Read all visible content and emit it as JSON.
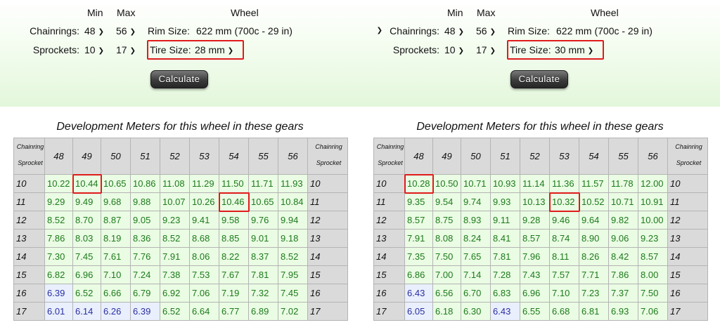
{
  "headers": {
    "min": "Min",
    "max": "Max",
    "wheel": "Wheel"
  },
  "labels": {
    "chainrings": "Chainrings:",
    "sprockets": "Sprockets:",
    "rim_size": "Rim Size:",
    "tire_size": "Tire Size:"
  },
  "panels": [
    {
      "chainring_min": "48",
      "chainring_max": "56",
      "sprocket_min": "10",
      "sprocket_max": "17",
      "rim_size": "622 mm (700c - 29 in)",
      "tire_size": "28 mm",
      "calculate": "Calculate",
      "table_title": "Development Meters for this wheel in these gears",
      "corner_top": "Chainring",
      "corner_bottom": "Sprocket",
      "columns": [
        "48",
        "49",
        "50",
        "51",
        "52",
        "53",
        "54",
        "55",
        "56"
      ],
      "rows": [
        {
          "sprocket": "10",
          "values": [
            "10.22",
            "10.44",
            "10.65",
            "10.86",
            "11.08",
            "11.29",
            "11.50",
            "11.71",
            "11.93"
          ]
        },
        {
          "sprocket": "11",
          "values": [
            "9.29",
            "9.49",
            "9.68",
            "9.88",
            "10.07",
            "10.26",
            "10.46",
            "10.65",
            "10.84"
          ]
        },
        {
          "sprocket": "12",
          "values": [
            "8.52",
            "8.70",
            "8.87",
            "9.05",
            "9.23",
            "9.41",
            "9.58",
            "9.76",
            "9.94"
          ]
        },
        {
          "sprocket": "13",
          "values": [
            "7.86",
            "8.03",
            "8.19",
            "8.36",
            "8.52",
            "8.68",
            "8.85",
            "9.01",
            "9.18"
          ]
        },
        {
          "sprocket": "14",
          "values": [
            "7.30",
            "7.45",
            "7.61",
            "7.76",
            "7.91",
            "8.06",
            "8.22",
            "8.37",
            "8.52"
          ]
        },
        {
          "sprocket": "15",
          "values": [
            "6.82",
            "6.96",
            "7.10",
            "7.24",
            "7.38",
            "7.53",
            "7.67",
            "7.81",
            "7.95"
          ]
        },
        {
          "sprocket": "16",
          "values": [
            "6.39",
            "6.52",
            "6.66",
            "6.79",
            "6.92",
            "7.06",
            "7.19",
            "7.32",
            "7.45"
          ]
        },
        {
          "sprocket": "17",
          "values": [
            "6.01",
            "6.14",
            "6.26",
            "6.39",
            "6.52",
            "6.64",
            "6.77",
            "6.89",
            "7.02"
          ]
        }
      ],
      "blue_cells": [
        [
          6,
          0
        ],
        [
          7,
          0
        ],
        [
          7,
          1
        ],
        [
          7,
          2
        ],
        [
          7,
          3
        ]
      ],
      "highlights": [
        [
          0,
          1
        ],
        [
          1,
          6
        ]
      ]
    },
    {
      "chainring_min": "48",
      "chainring_max": "56",
      "sprocket_min": "10",
      "sprocket_max": "17",
      "rim_size": "622 mm (700c - 29 in)",
      "tire_size": "30 mm",
      "calculate": "Calculate",
      "table_title": "Development Meters for this wheel in these gears",
      "corner_top": "Chainring",
      "corner_bottom": "Sprocket",
      "columns": [
        "48",
        "49",
        "50",
        "51",
        "52",
        "53",
        "54",
        "55",
        "56"
      ],
      "rows": [
        {
          "sprocket": "10",
          "values": [
            "10.28",
            "10.50",
            "10.71",
            "10.93",
            "11.14",
            "11.36",
            "11.57",
            "11.78",
            "12.00"
          ]
        },
        {
          "sprocket": "11",
          "values": [
            "9.35",
            "9.54",
            "9.74",
            "9.93",
            "10.13",
            "10.32",
            "10.52",
            "10.71",
            "10.91"
          ]
        },
        {
          "sprocket": "12",
          "values": [
            "8.57",
            "8.75",
            "8.93",
            "9.11",
            "9.28",
            "9.46",
            "9.64",
            "9.82",
            "10.00"
          ]
        },
        {
          "sprocket": "13",
          "values": [
            "7.91",
            "8.08",
            "8.24",
            "8.41",
            "8.57",
            "8.74",
            "8.90",
            "9.06",
            "9.23"
          ]
        },
        {
          "sprocket": "14",
          "values": [
            "7.35",
            "7.50",
            "7.65",
            "7.81",
            "7.96",
            "8.11",
            "8.26",
            "8.42",
            "8.57"
          ]
        },
        {
          "sprocket": "15",
          "values": [
            "6.86",
            "7.00",
            "7.14",
            "7.28",
            "7.43",
            "7.57",
            "7.71",
            "7.86",
            "8.00"
          ]
        },
        {
          "sprocket": "16",
          "values": [
            "6.43",
            "6.56",
            "6.70",
            "6.83",
            "6.96",
            "7.10",
            "7.23",
            "7.37",
            "7.50"
          ]
        },
        {
          "sprocket": "17",
          "values": [
            "6.05",
            "6.18",
            "6.30",
            "6.43",
            "6.55",
            "6.68",
            "6.81",
            "6.93",
            "7.06"
          ]
        }
      ],
      "blue_cells": [
        [
          6,
          0
        ],
        [
          7,
          0
        ],
        [
          7,
          3
        ]
      ],
      "highlights": [
        [
          0,
          0
        ],
        [
          1,
          5
        ]
      ]
    }
  ],
  "colors": {
    "highlight": "#e01b1b",
    "cell_green_bg": "#eafce3",
    "cell_green_text": "#1d7a1d",
    "cell_blue_bg": "#e9effd",
    "cell_blue_text": "#2b2fa0",
    "header_bg": "#dadada"
  },
  "icons": {
    "select_arrow": "chevron-down-icon"
  }
}
